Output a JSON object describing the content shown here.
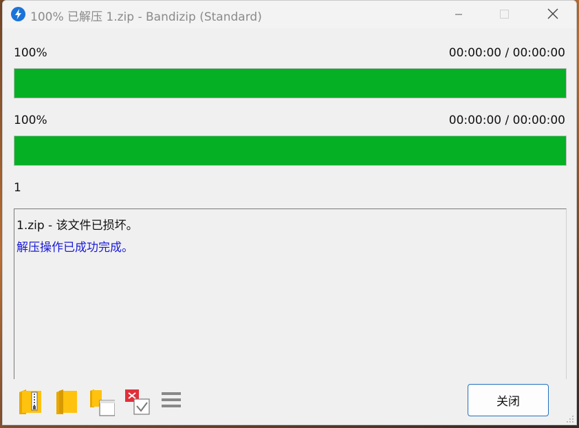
{
  "window": {
    "title": "100% 已解压 1.zip - Bandizip (Standard)"
  },
  "progress": [
    {
      "percent_label": "100%",
      "time_label": "00:00:00 / 00:00:00",
      "fill_fraction": 1.0
    },
    {
      "percent_label": "100%",
      "time_label": "00:00:00 / 00:00:00",
      "fill_fraction": 1.0
    }
  ],
  "file_count": "1",
  "log": {
    "lines": [
      {
        "text": "1.zip - 该文件已损坏。",
        "color": "#111111"
      },
      {
        "text": "解压操作已成功完成。",
        "color": "#1a1ad8"
      }
    ]
  },
  "toolbar": {
    "icons": [
      "zip-folder-icon",
      "open-folder-icon",
      "copy-window-icon",
      "close-on-finish-icon",
      "menu-icon"
    ]
  },
  "buttons": {
    "close_label": "关闭"
  },
  "colors": {
    "progress_fill": "#06b025",
    "accent": "#1f6fbf",
    "app_icon": "#1a73d9"
  }
}
